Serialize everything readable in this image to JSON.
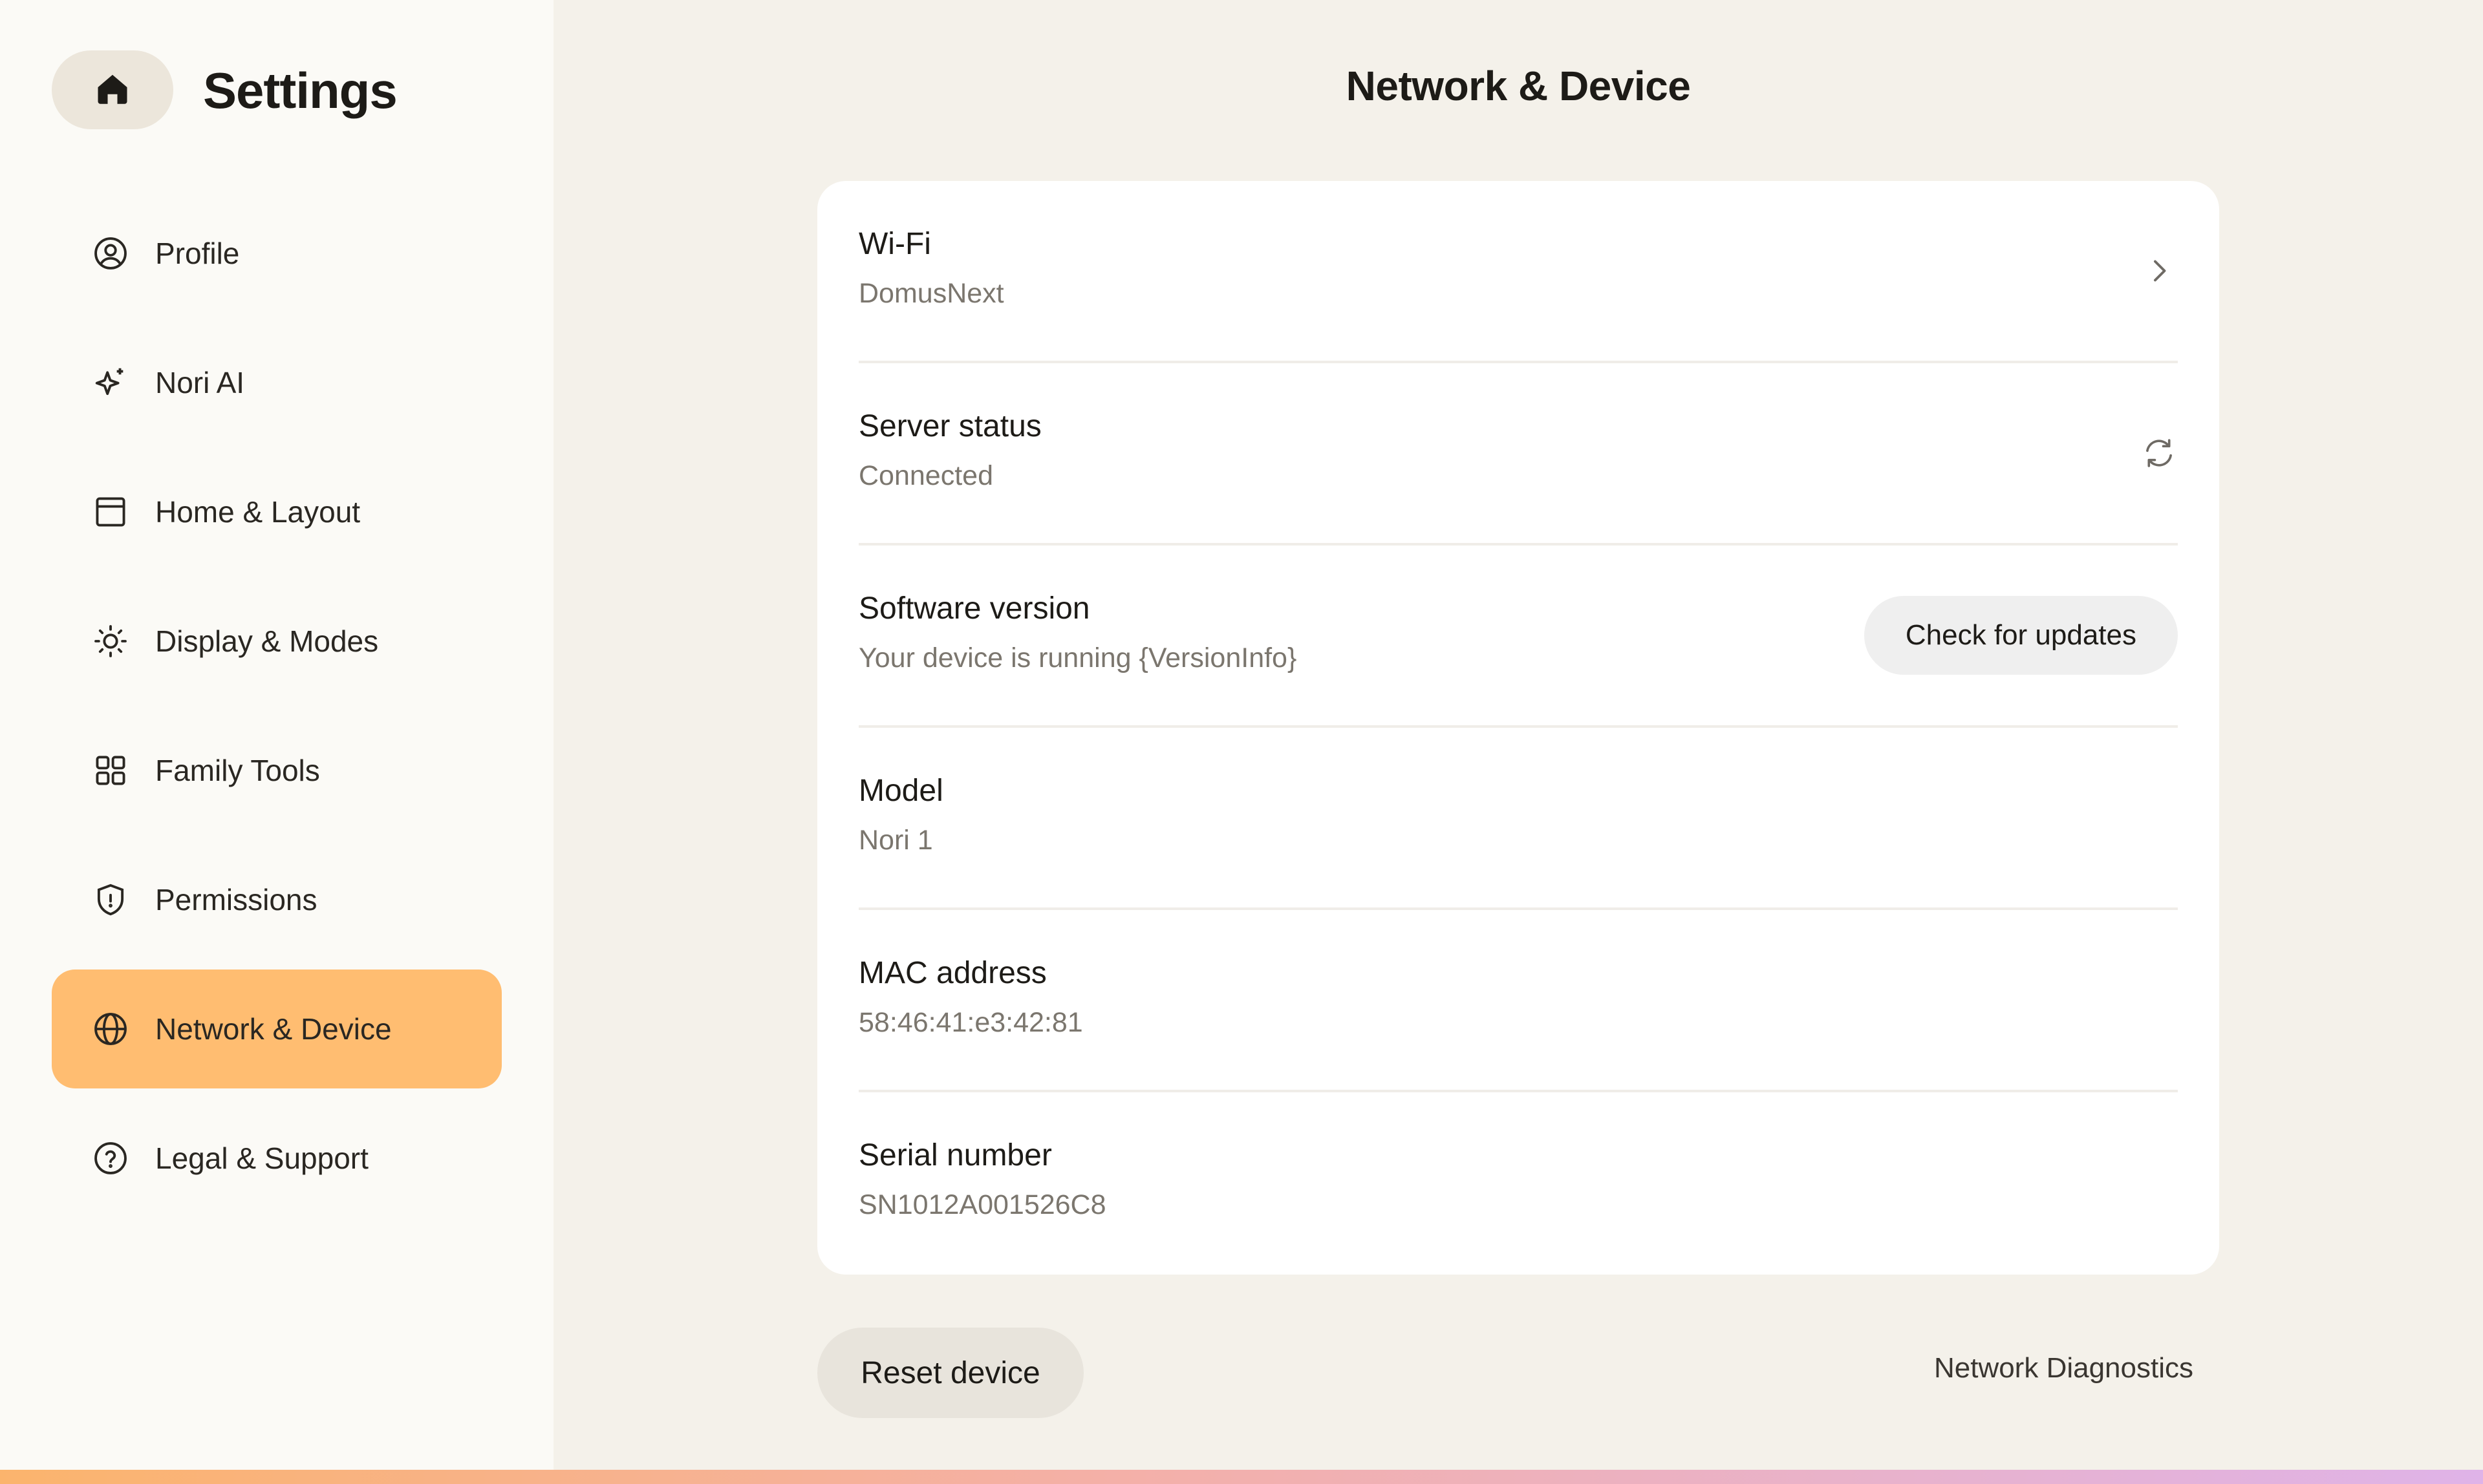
{
  "sidebar": {
    "title": "Settings",
    "home_icon": "home-icon",
    "items": [
      {
        "label": "Profile",
        "icon": "user-circle-icon",
        "active": false
      },
      {
        "label": "Nori AI",
        "icon": "sparkle-icon",
        "active": false
      },
      {
        "label": "Home & Layout",
        "icon": "layout-icon",
        "active": false
      },
      {
        "label": "Display & Modes",
        "icon": "sun-icon",
        "active": false
      },
      {
        "label": "Family Tools",
        "icon": "grid-icon",
        "active": false
      },
      {
        "label": "Permissions",
        "icon": "shield-icon",
        "active": false
      },
      {
        "label": "Network & Device",
        "icon": "globe-icon",
        "active": true
      },
      {
        "label": "Legal & Support",
        "icon": "help-circle-icon",
        "active": false
      }
    ]
  },
  "main": {
    "title": "Network & Device",
    "rows": [
      {
        "title": "Wi-Fi",
        "value": "DomusNext",
        "action": "chevron-right-icon"
      },
      {
        "title": "Server status",
        "value": "Connected",
        "action": "refresh-icon"
      },
      {
        "title": "Software version",
        "value": "Your device is running {VersionInfo}",
        "action_label": "Check for updates"
      },
      {
        "title": "Model",
        "value": "Nori 1"
      },
      {
        "title": "MAC address",
        "value": "58:46:41:e3:42:81"
      },
      {
        "title": "Serial number",
        "value": "SN1012A001526C8"
      }
    ],
    "reset_label": "Reset device",
    "diagnostics_label": "Network Diagnostics"
  },
  "colors": {
    "sidebar_bg": "#fbfaf6",
    "main_bg": "#f4f1ea",
    "active_item": "#ffbd71",
    "card_bg": "#ffffff",
    "muted_text": "#7b766e"
  }
}
